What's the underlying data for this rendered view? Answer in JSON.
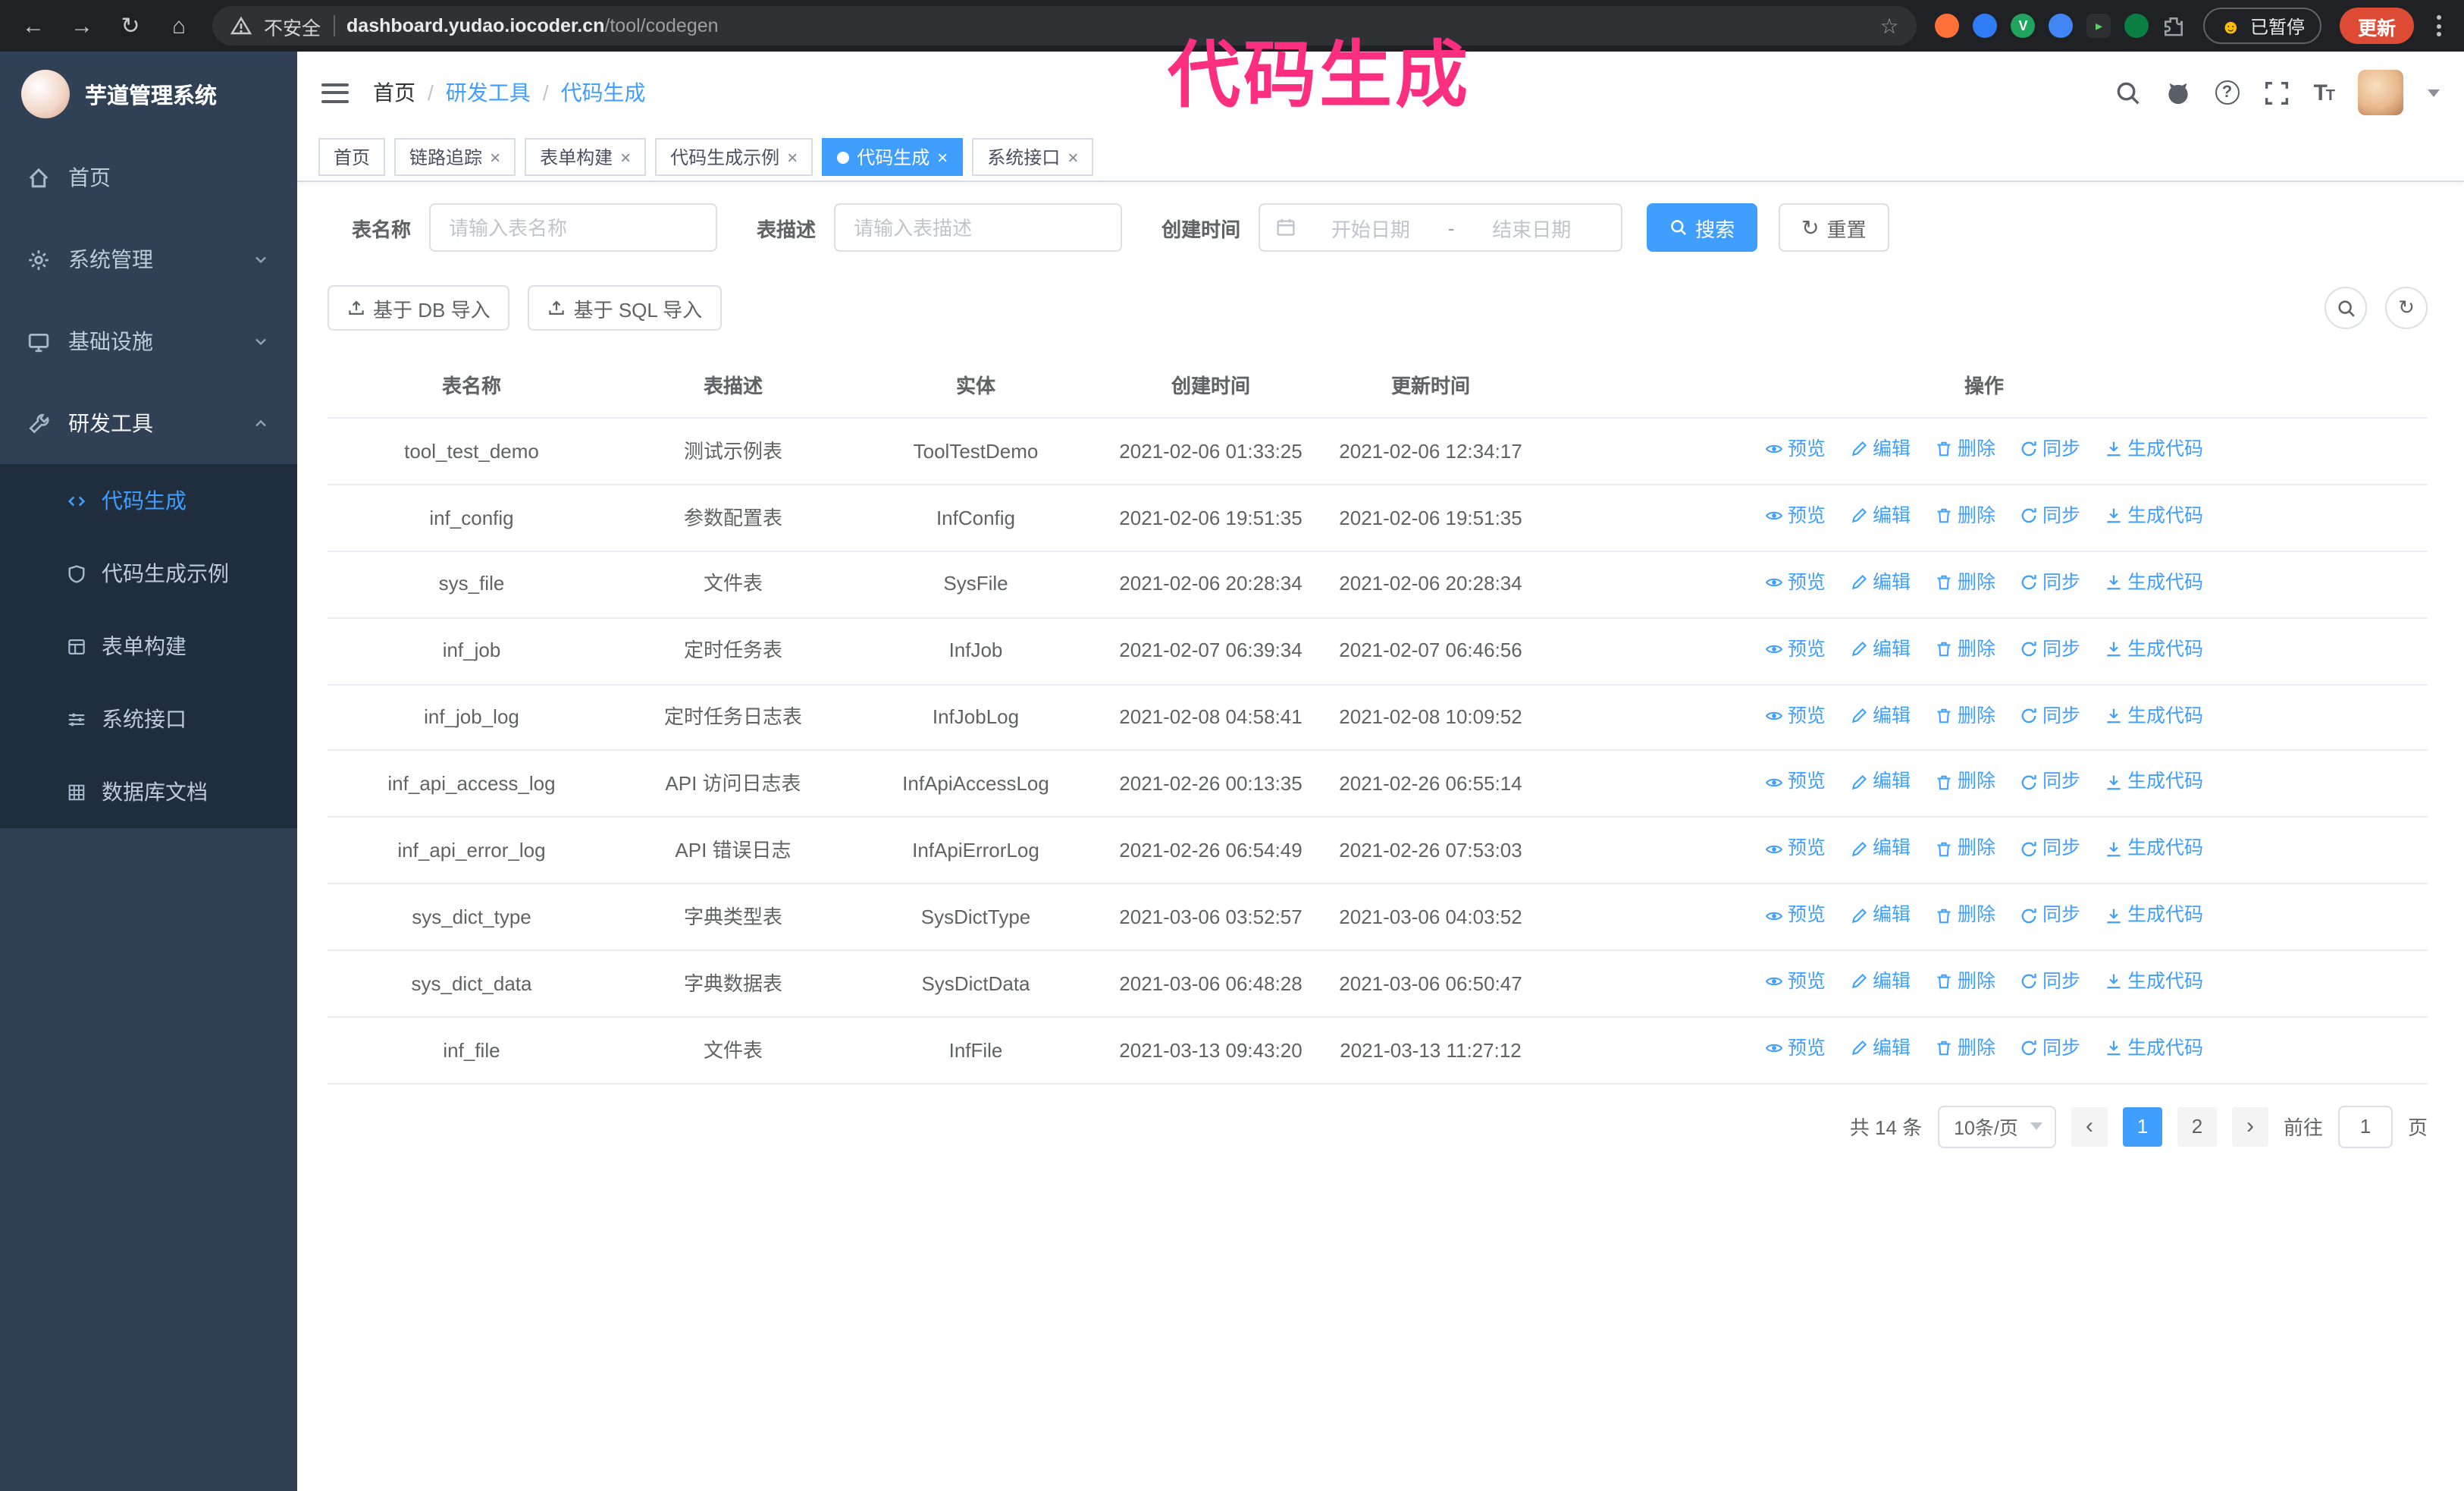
{
  "colors": {
    "accent": "#409EFF",
    "sidebar_bg": "#304156",
    "submenu_bg": "#1f2d3d",
    "annotation_pink": "#fb2e7f",
    "update_button": "#dd4b35",
    "chrome_bg": "#202124"
  },
  "annotation": {
    "text": "代码生成"
  },
  "browser": {
    "security_label": "不安全",
    "url_host": "dashboard.yudao.iocoder.cn",
    "url_path": "/tool/codegen",
    "profile_chip": "已暂停",
    "update_label": "更新",
    "nav_icons": [
      "back-icon",
      "forward-icon",
      "reload-icon",
      "home-icon",
      "bookmark-star-icon",
      "extensions-puzzle-icon",
      "menu-kebab-icon"
    ]
  },
  "sidebar": {
    "logo_title": "芋道管理系统",
    "items": [
      {
        "label": "首页",
        "icon": "home-icon"
      },
      {
        "label": "系统管理",
        "icon": "gear-icon",
        "chevron": "down"
      },
      {
        "label": "基础设施",
        "icon": "monitor-icon",
        "chevron": "down"
      },
      {
        "label": "研发工具",
        "icon": "tools-icon",
        "chevron": "up",
        "expanded": true
      }
    ],
    "submenu": [
      {
        "label": "代码生成",
        "icon": "code-icon",
        "active": true
      },
      {
        "label": "代码生成示例",
        "icon": "shield-icon",
        "active": false
      },
      {
        "label": "表单构建",
        "icon": "form-icon",
        "active": false
      },
      {
        "label": "系统接口",
        "icon": "sliders-icon",
        "active": false
      },
      {
        "label": "数据库文档",
        "icon": "grid-icon",
        "active": false
      }
    ]
  },
  "header": {
    "breadcrumb": [
      {
        "label": "首页"
      },
      {
        "label": "研发工具"
      },
      {
        "label": "代码生成"
      }
    ],
    "icons": [
      "search-icon",
      "github-icon",
      "help-icon",
      "fullscreen-icon",
      "fontsize-icon",
      "avatar"
    ]
  },
  "tabs": [
    {
      "label": "首页",
      "closable": false,
      "active": false
    },
    {
      "label": "链路追踪",
      "closable": true,
      "active": false
    },
    {
      "label": "表单构建",
      "closable": true,
      "active": false
    },
    {
      "label": "代码生成示例",
      "closable": true,
      "active": false
    },
    {
      "label": "代码生成",
      "closable": true,
      "active": true
    },
    {
      "label": "系统接口",
      "closable": true,
      "active": false
    }
  ],
  "filters": {
    "table_name_label": "表名称",
    "table_name_placeholder": "请输入表名称",
    "table_desc_label": "表描述",
    "table_desc_placeholder": "请输入表描述",
    "create_time_label": "创建时间",
    "date_start_placeholder": "开始日期",
    "date_separator": "-",
    "date_end_placeholder": "结束日期",
    "search_label": "搜索",
    "reset_label": "重置"
  },
  "toolbar": {
    "import_db_label": "基于 DB 导入",
    "import_sql_label": "基于 SQL 导入",
    "icon": "upload-icon",
    "round_buttons": [
      "toggle-search-icon",
      "refresh-icon"
    ]
  },
  "table": {
    "columns": [
      "表名称",
      "表描述",
      "实体",
      "创建时间",
      "更新时间",
      "操作"
    ],
    "actions": [
      {
        "label": "预览",
        "icon": "eye-icon"
      },
      {
        "label": "编辑",
        "icon": "edit-icon"
      },
      {
        "label": "删除",
        "icon": "delete-icon"
      },
      {
        "label": "同步",
        "icon": "sync-icon"
      },
      {
        "label": "生成代码",
        "icon": "download-icon"
      }
    ],
    "rows": [
      {
        "name": "tool_test_demo",
        "desc": "测试示例表",
        "entity": "ToolTestDemo",
        "created": "2021-02-06 01:33:25",
        "updated": "2021-02-06 12:34:17"
      },
      {
        "name": "inf_config",
        "desc": "参数配置表",
        "entity": "InfConfig",
        "created": "2021-02-06 19:51:35",
        "updated": "2021-02-06 19:51:35"
      },
      {
        "name": "sys_file",
        "desc": "文件表",
        "entity": "SysFile",
        "created": "2021-02-06 20:28:34",
        "updated": "2021-02-06 20:28:34"
      },
      {
        "name": "inf_job",
        "desc": "定时任务表",
        "entity": "InfJob",
        "created": "2021-02-07 06:39:34",
        "updated": "2021-02-07 06:46:56"
      },
      {
        "name": "inf_job_log",
        "desc": "定时任务日志表",
        "entity": "InfJobLog",
        "created": "2021-02-08 04:58:41",
        "updated": "2021-02-08 10:09:52"
      },
      {
        "name": "inf_api_access_log",
        "desc": "API 访问日志表",
        "entity": "InfApiAccessLog",
        "created": "2021-02-26 00:13:35",
        "updated": "2021-02-26 06:55:14"
      },
      {
        "name": "inf_api_error_log",
        "desc": "API 错误日志",
        "entity": "InfApiErrorLog",
        "created": "2021-02-26 06:54:49",
        "updated": "2021-02-26 07:53:03"
      },
      {
        "name": "sys_dict_type",
        "desc": "字典类型表",
        "entity": "SysDictType",
        "created": "2021-03-06 03:52:57",
        "updated": "2021-03-06 04:03:52"
      },
      {
        "name": "sys_dict_data",
        "desc": "字典数据表",
        "entity": "SysDictData",
        "created": "2021-03-06 06:48:28",
        "updated": "2021-03-06 06:50:47"
      },
      {
        "name": "inf_file",
        "desc": "文件表",
        "entity": "InfFile",
        "created": "2021-03-13 09:43:20",
        "updated": "2021-03-13 11:27:12"
      }
    ]
  },
  "pagination": {
    "total_text": "共 14 条",
    "page_size_text": "10条/页",
    "pages": [
      "1",
      "2"
    ],
    "active_page": "1",
    "goto_label": "前往",
    "goto_value": "1",
    "goto_suffix": "页"
  }
}
